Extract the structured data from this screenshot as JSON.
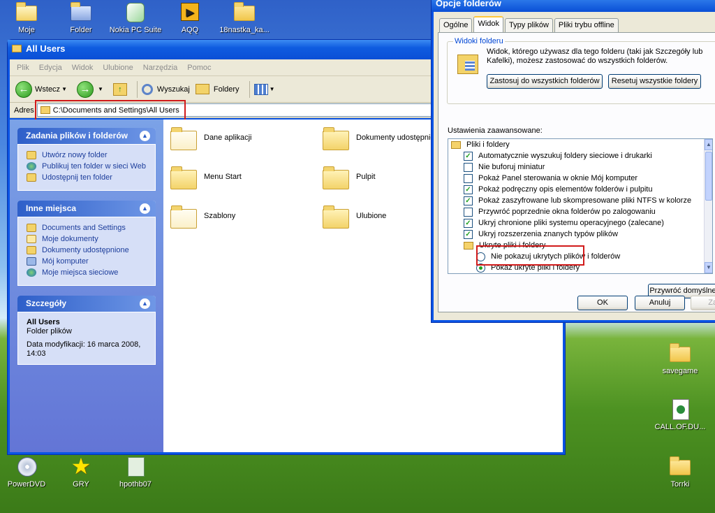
{
  "desktop": {
    "top_icons": [
      {
        "label": "Moje"
      },
      {
        "label": "Folder"
      },
      {
        "label": "Nokia PC Suite"
      },
      {
        "label": "AQQ"
      },
      {
        "label": "18nastka_ka..."
      }
    ],
    "bottom_icons": [
      {
        "label": "PowerDVD"
      },
      {
        "label": "GRY"
      },
      {
        "label": "hpothb07"
      }
    ],
    "right_icons": [
      {
        "label": "savegame"
      },
      {
        "label": "CALL.OF.DU..."
      },
      {
        "label": "Torrki"
      }
    ]
  },
  "explorer": {
    "title": "All Users",
    "menu": [
      "Plik",
      "Edycja",
      "Widok",
      "Ulubione",
      "Narzędzia",
      "Pomoc"
    ],
    "toolbar": {
      "back": "Wstecz",
      "search": "Wyszukaj",
      "folders": "Foldery"
    },
    "address": {
      "label": "Adres",
      "path": "C:\\Documents and Settings\\All Users"
    },
    "panels": {
      "tasks": {
        "title": "Zadania plików i folderów",
        "items": [
          "Utwórz nowy folder",
          "Publikuj ten folder w sieci Web",
          "Udostępnij ten folder"
        ]
      },
      "places": {
        "title": "Inne miejsca",
        "items": [
          "Documents and Settings",
          "Moje dokumenty",
          "Dokumenty udostępnione",
          "Mój komputer",
          "Moje miejsca sieciowe"
        ]
      },
      "details": {
        "title": "Szczegóły",
        "name": "All Users",
        "type": "Folder plików",
        "modified": "Data modyfikacji: 16 marca 2008, 14:03"
      }
    },
    "folders": [
      "Dane aplikacji",
      "Dokumenty udostępnione",
      "Menu Start",
      "Pulpit",
      "Szablony",
      "Ulubione"
    ]
  },
  "dialog": {
    "title": "Opcje folderów",
    "tabs": [
      "Ogólne",
      "Widok",
      "Typy plików",
      "Pliki trybu offline"
    ],
    "active_tab": "Widok",
    "views_group": {
      "legend": "Widoki folderu",
      "desc": "Widok, którego używasz dla tego folderu (taki jak Szczegóły lub Kafelki), możesz zastosować do wszystkich folderów.",
      "apply_all": "Zastosuj do wszystkich folderów",
      "reset_all": "Resetuj wszystkie foldery"
    },
    "advanced_label": "Ustawienia zaawansowane:",
    "tree": {
      "root": "Pliki i foldery",
      "checks": [
        {
          "label": "Automatycznie wyszukuj foldery sieciowe i drukarki",
          "checked": true
        },
        {
          "label": "Nie buforuj miniatur",
          "checked": false
        },
        {
          "label": "Pokaż Panel sterowania w oknie Mój komputer",
          "checked": false
        },
        {
          "label": "Pokaż podręczny opis elementów folderów i pulpitu",
          "checked": true
        },
        {
          "label": "Pokaż zaszyfrowane lub skompresowane pliki NTFS w kolorze",
          "checked": true
        },
        {
          "label": "Przywróć poprzednie okna folderów po zalogowaniu",
          "checked": false
        },
        {
          "label": "Ukryj chronione pliki systemu operacyjnego (zalecane)",
          "checked": true
        },
        {
          "label": "Ukryj rozszerzenia znanych typów plików",
          "checked": true
        }
      ],
      "hidden_folder": "Ukryte pliki i foldery",
      "radios": [
        {
          "label": "Nie pokazuj ukrytych plików i folderów",
          "selected": false
        },
        {
          "label": "Pokaż ukryte pliki i foldery",
          "selected": true
        }
      ]
    },
    "restore_defaults": "Przywróć domyślne",
    "ok": "OK",
    "cancel": "Anuluj",
    "apply": "Zast"
  }
}
